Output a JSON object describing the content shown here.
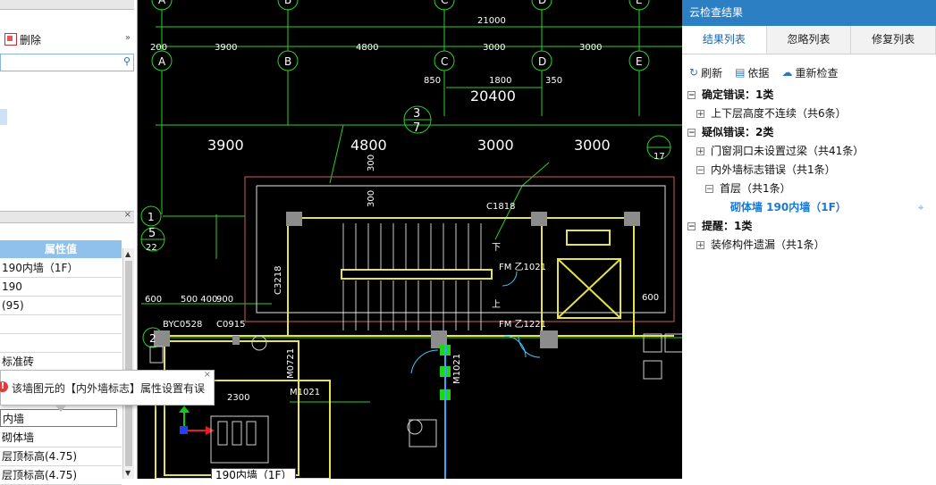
{
  "left_panel": {
    "delete_label": "删除",
    "property_header": "属性值",
    "property_rows": [
      "190内墙（1F）",
      "190",
      "(95)",
      "",
      "",
      "标准砖"
    ],
    "input_value": "内墙",
    "lower_rows": [
      "砌体墙",
      "层顶标高(4.75)",
      "层顶标高(4.75)"
    ]
  },
  "tooltip": {
    "message": "该墙图元的【内外墙标志】属性设置有误"
  },
  "cad": {
    "selected_label": "190内墙（1F）",
    "axes_top": [
      "A",
      "B",
      "C",
      "D",
      "E"
    ],
    "axes_left": [
      "1",
      "2"
    ],
    "total_dim": "21000",
    "dims_small": [
      "200",
      "3900",
      "4800",
      "3000",
      "3000"
    ],
    "dims_large": [
      "3900",
      "4800",
      "3000",
      "3000"
    ],
    "dims_mid": [
      "850",
      "1800",
      "350"
    ],
    "dim_big": "20400",
    "dims_bottom": [
      "600",
      "500 400",
      "900"
    ],
    "dim_2300": "2300",
    "circle_label_top": "3",
    "circle_label_bottom": "7",
    "circle_left_top": "5",
    "circle_left_bottom": "22",
    "circle_right_top": "17",
    "labels": [
      "C1818",
      "C3218",
      "FM 乙1021",
      "FM 乙1221",
      "BYC0528",
      "C0915",
      "M0721",
      "M1021",
      "M1021",
      "上",
      "下",
      "600",
      "300",
      "300"
    ]
  },
  "right_panel": {
    "title": "云检查结果",
    "tabs": [
      "结果列表",
      "忽略列表",
      "修复列表"
    ],
    "active_tab": 0,
    "tools": [
      {
        "icon": "refresh-icon",
        "label": "刷新"
      },
      {
        "icon": "basis-icon",
        "label": "依据"
      },
      {
        "icon": "cloud-icon",
        "label": "重新检查"
      }
    ],
    "tree": [
      {
        "label": "确定错误：1类",
        "level": 0,
        "toggle": "−",
        "bold": true
      },
      {
        "label": "上下层高度不连续（共6条）",
        "level": 1,
        "toggle": "+"
      },
      {
        "label": "疑似错误：2类",
        "level": 0,
        "toggle": "−",
        "bold": true
      },
      {
        "label": "门窗洞口未设置过梁（共41条）",
        "level": 1,
        "toggle": "+"
      },
      {
        "label": "内外墙标志错误（共1条）",
        "level": 1,
        "toggle": "−"
      },
      {
        "label": "首层（共1条）",
        "level": 2,
        "toggle": "−"
      },
      {
        "label": "砌体墙 190内墙（1F）",
        "level": 3,
        "toggle": "",
        "selected": true
      },
      {
        "label": "提醒：1类",
        "level": 0,
        "toggle": "−",
        "bold": true
      },
      {
        "label": "装修构件遗漏（共1条）",
        "level": 1,
        "toggle": "+"
      }
    ]
  }
}
